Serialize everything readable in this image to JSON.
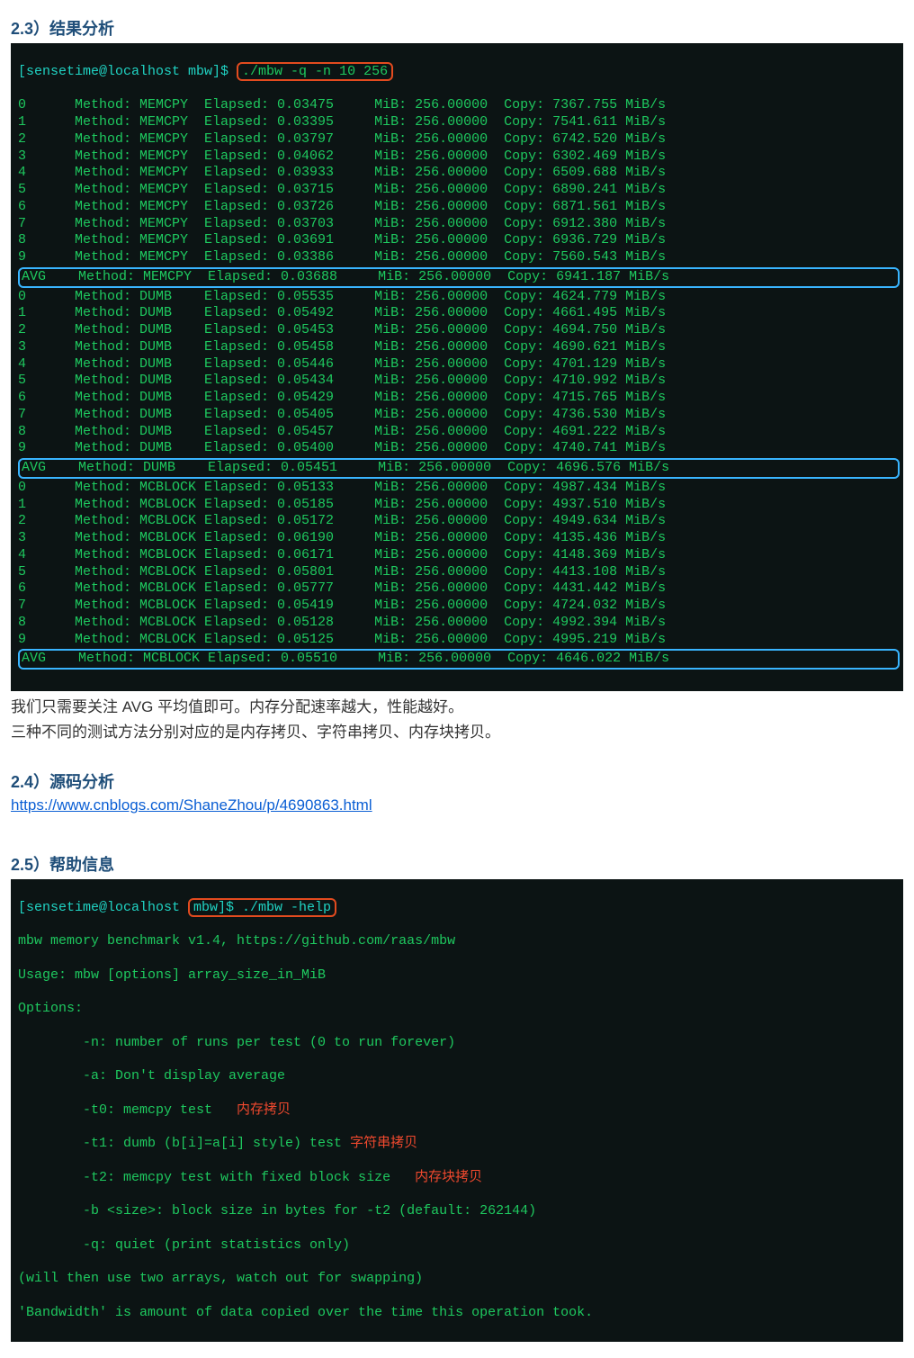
{
  "sec23": {
    "heading": "2.3）结果分析"
  },
  "term1": {
    "prompt": "[sensetime@localhost mbw]$ ",
    "command": "./mbw -q -n 10 256",
    "rows": [
      {
        "idx": "0",
        "method": "MEMCPY",
        "elapsed": "0.03475",
        "mib": "256.00000",
        "copy": "7367.755",
        "avg": false
      },
      {
        "idx": "1",
        "method": "MEMCPY",
        "elapsed": "0.03395",
        "mib": "256.00000",
        "copy": "7541.611",
        "avg": false
      },
      {
        "idx": "2",
        "method": "MEMCPY",
        "elapsed": "0.03797",
        "mib": "256.00000",
        "copy": "6742.520",
        "avg": false
      },
      {
        "idx": "3",
        "method": "MEMCPY",
        "elapsed": "0.04062",
        "mib": "256.00000",
        "copy": "6302.469",
        "avg": false
      },
      {
        "idx": "4",
        "method": "MEMCPY",
        "elapsed": "0.03933",
        "mib": "256.00000",
        "copy": "6509.688",
        "avg": false
      },
      {
        "idx": "5",
        "method": "MEMCPY",
        "elapsed": "0.03715",
        "mib": "256.00000",
        "copy": "6890.241",
        "avg": false
      },
      {
        "idx": "6",
        "method": "MEMCPY",
        "elapsed": "0.03726",
        "mib": "256.00000",
        "copy": "6871.561",
        "avg": false
      },
      {
        "idx": "7",
        "method": "MEMCPY",
        "elapsed": "0.03703",
        "mib": "256.00000",
        "copy": "6912.380",
        "avg": false
      },
      {
        "idx": "8",
        "method": "MEMCPY",
        "elapsed": "0.03691",
        "mib": "256.00000",
        "copy": "6936.729",
        "avg": false
      },
      {
        "idx": "9",
        "method": "MEMCPY",
        "elapsed": "0.03386",
        "mib": "256.00000",
        "copy": "7560.543",
        "avg": false
      },
      {
        "idx": "AVG",
        "method": "MEMCPY",
        "elapsed": "0.03688",
        "mib": "256.00000",
        "copy": "6941.187",
        "avg": true
      },
      {
        "idx": "0",
        "method": "DUMB",
        "elapsed": "0.05535",
        "mib": "256.00000",
        "copy": "4624.779",
        "avg": false
      },
      {
        "idx": "1",
        "method": "DUMB",
        "elapsed": "0.05492",
        "mib": "256.00000",
        "copy": "4661.495",
        "avg": false
      },
      {
        "idx": "2",
        "method": "DUMB",
        "elapsed": "0.05453",
        "mib": "256.00000",
        "copy": "4694.750",
        "avg": false
      },
      {
        "idx": "3",
        "method": "DUMB",
        "elapsed": "0.05458",
        "mib": "256.00000",
        "copy": "4690.621",
        "avg": false
      },
      {
        "idx": "4",
        "method": "DUMB",
        "elapsed": "0.05446",
        "mib": "256.00000",
        "copy": "4701.129",
        "avg": false
      },
      {
        "idx": "5",
        "method": "DUMB",
        "elapsed": "0.05434",
        "mib": "256.00000",
        "copy": "4710.992",
        "avg": false
      },
      {
        "idx": "6",
        "method": "DUMB",
        "elapsed": "0.05429",
        "mib": "256.00000",
        "copy": "4715.765",
        "avg": false
      },
      {
        "idx": "7",
        "method": "DUMB",
        "elapsed": "0.05405",
        "mib": "256.00000",
        "copy": "4736.530",
        "avg": false
      },
      {
        "idx": "8",
        "method": "DUMB",
        "elapsed": "0.05457",
        "mib": "256.00000",
        "copy": "4691.222",
        "avg": false
      },
      {
        "idx": "9",
        "method": "DUMB",
        "elapsed": "0.05400",
        "mib": "256.00000",
        "copy": "4740.741",
        "avg": false
      },
      {
        "idx": "AVG",
        "method": "DUMB",
        "elapsed": "0.05451",
        "mib": "256.00000",
        "copy": "4696.576",
        "avg": true
      },
      {
        "idx": "0",
        "method": "MCBLOCK",
        "elapsed": "0.05133",
        "mib": "256.00000",
        "copy": "4987.434",
        "avg": false
      },
      {
        "idx": "1",
        "method": "MCBLOCK",
        "elapsed": "0.05185",
        "mib": "256.00000",
        "copy": "4937.510",
        "avg": false
      },
      {
        "idx": "2",
        "method": "MCBLOCK",
        "elapsed": "0.05172",
        "mib": "256.00000",
        "copy": "4949.634",
        "avg": false
      },
      {
        "idx": "3",
        "method": "MCBLOCK",
        "elapsed": "0.06190",
        "mib": "256.00000",
        "copy": "4135.436",
        "avg": false
      },
      {
        "idx": "4",
        "method": "MCBLOCK",
        "elapsed": "0.06171",
        "mib": "256.00000",
        "copy": "4148.369",
        "avg": false
      },
      {
        "idx": "5",
        "method": "MCBLOCK",
        "elapsed": "0.05801",
        "mib": "256.00000",
        "copy": "4413.108",
        "avg": false
      },
      {
        "idx": "6",
        "method": "MCBLOCK",
        "elapsed": "0.05777",
        "mib": "256.00000",
        "copy": "4431.442",
        "avg": false
      },
      {
        "idx": "7",
        "method": "MCBLOCK",
        "elapsed": "0.05419",
        "mib": "256.00000",
        "copy": "4724.032",
        "avg": false
      },
      {
        "idx": "8",
        "method": "MCBLOCK",
        "elapsed": "0.05128",
        "mib": "256.00000",
        "copy": "4992.394",
        "avg": false
      },
      {
        "idx": "9",
        "method": "MCBLOCK",
        "elapsed": "0.05125",
        "mib": "256.00000",
        "copy": "4995.219",
        "avg": false
      },
      {
        "idx": "AVG",
        "method": "MCBLOCK",
        "elapsed": "0.05510",
        "mib": "256.00000",
        "copy": "4646.022",
        "avg": true
      }
    ]
  },
  "analysis1": "我们只需要关注 AVG 平均值即可。内存分配速率越大，性能越好。",
  "analysis2": "三种不同的测试方法分别对应的是内存拷贝、字符串拷贝、内存块拷贝。",
  "sec24": {
    "heading": "2.4）源码分析"
  },
  "link": {
    "text": "https://www.cnblogs.com/ShaneZhou/p/4690863.html"
  },
  "sec25": {
    "heading": "2.5）帮助信息"
  },
  "term2": {
    "prompt_left": "[sensetime@localhost ",
    "prompt_box": "mbw]$ ./mbw -help",
    "line1": "mbw memory benchmark v1.4, https://github.com/raas/mbw",
    "line2": "Usage: mbw [options] array_size_in_MiB",
    "line3": "Options:",
    "opt_n": "        -n: number of runs per test (0 to run forever)",
    "opt_a": "        -a: Don't display average",
    "opt_t0": "        -t0: memcpy test",
    "anno_t0": "   内存拷贝",
    "opt_t1": "        -t1: dumb (b[i]=a[i] style) test",
    "anno_t1": " 字符串拷贝",
    "opt_t2": "        -t2: memcpy test with fixed block size",
    "anno_t2": "   内存块拷贝",
    "opt_b": "        -b <size>: block size in bytes for -t2 (default: 262144)",
    "opt_q": "        -q: quiet (print statistics only)",
    "line_swap": "(will then use two arrays, watch out for swapping)",
    "line_bw": "'Bandwidth' is amount of data copied over the time this operation took."
  },
  "labels": {
    "method": "Method:",
    "elapsed": "Elapsed:",
    "mib": "MiB:",
    "copy": "Copy:",
    "mibs": "MiB/s"
  }
}
